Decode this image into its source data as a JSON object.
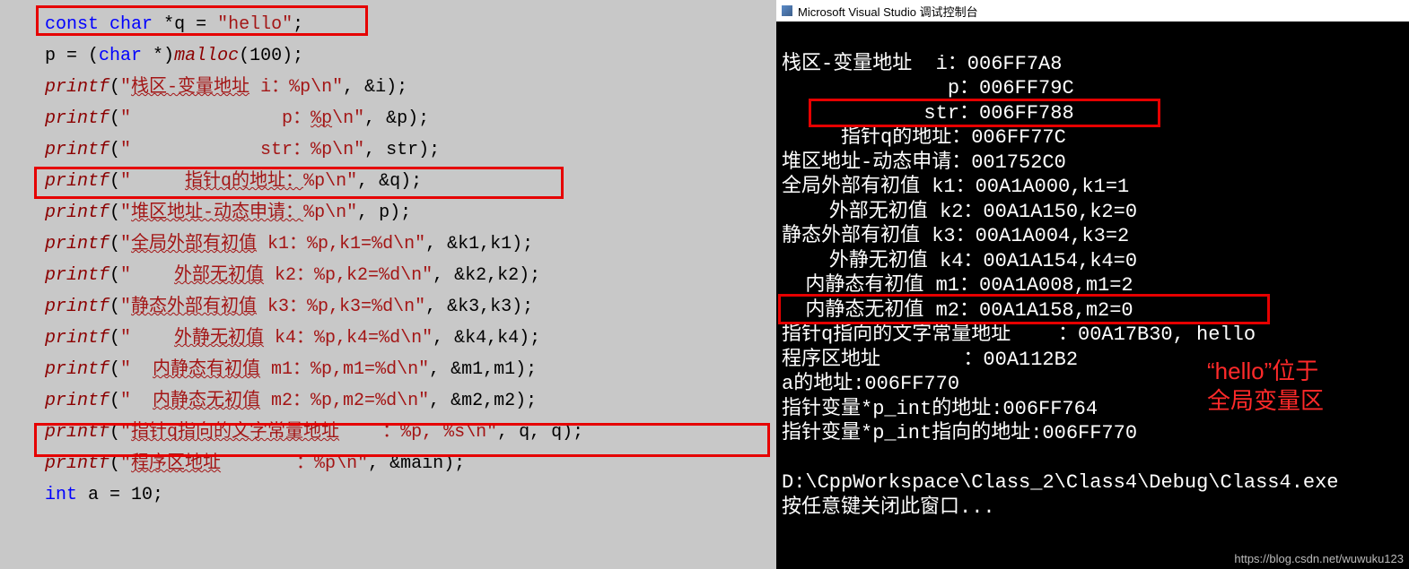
{
  "code": {
    "l1": "const char *q = \"hello\";",
    "l2": "p = (char *)malloc(100);",
    "l3": "printf(\"栈区-变量地址  i：%p\\n\", &i);",
    "l4": "printf(\"              p：%p\\n\", &p);",
    "l5": "printf(\"            str：%p\\n\", str);",
    "l6": "printf(\"     指针q的地址：%p\\n\", &q);",
    "l7": "printf(\"堆区地址-动态申请：%p\\n\", p);",
    "l8": "printf(\"全局外部有初值 k1：%p,k1=%d\\n\", &k1,k1);",
    "l9": "printf(\"    外部无初值 k2：%p,k2=%d\\n\", &k2,k2);",
    "l10": "printf(\"静态外部有初值 k3：%p,k3=%d\\n\", &k3,k3);",
    "l11": "printf(\"    外静无初值 k4：%p,k4=%d\\n\", &k4,k4);",
    "l12": "printf(\"  内静态有初值 m1：%p,m1=%d\\n\", &m1,m1);",
    "l13": "printf(\"  内静态无初值 m2：%p,m2=%d\\n\", &m2,m2);",
    "l14": "printf(\"指针q指向的文字常量地址    ：%p, %s\\n\", q, q);",
    "l15": "printf(\"程序区地址       ：%p\\n\", &main);",
    "l16": "int a = 10;"
  },
  "console": {
    "title": "Microsoft Visual Studio 调试控制台",
    "lines": [
      "栈区-变量地址  i：006FF7A8",
      "              p：006FF79C",
      "            str：006FF788",
      "     指针q的地址：006FF77C",
      "堆区地址-动态申请：001752C0",
      "全局外部有初值 k1：00A1A000,k1=1",
      "    外部无初值 k2：00A1A150,k2=0",
      "静态外部有初值 k3：00A1A004,k3=2",
      "    外静无初值 k4：00A1A154,k4=0",
      "  内静态有初值 m1：00A1A008,m1=2",
      "  内静态无初值 m2：00A1A158,m2=0",
      "指针q指向的文字常量地址    ：00A17B30, hello",
      "程序区地址       ：00A112B2",
      "a的地址:006FF770",
      "指针变量*p_int的地址:006FF764",
      "指针变量*p_int指向的地址:006FF770",
      "",
      "D:\\CppWorkspace\\Class_2\\Class4\\Debug\\Class4.exe",
      "按任意键关闭此窗口..."
    ]
  },
  "annotation": {
    "line1": "“hello”位于",
    "line2": "全局变量区"
  },
  "watermark": "https://blog.csdn.net/wuwuku123"
}
